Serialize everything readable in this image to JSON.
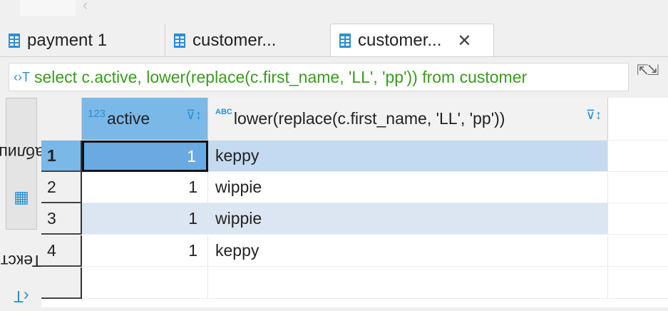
{
  "tabs": [
    {
      "label": "payment 1",
      "active": false
    },
    {
      "label": "customer...",
      "active": false
    },
    {
      "label": "customer...",
      "active": true
    }
  ],
  "query": "select c.active, lower(replace(c.first_name, 'LL', 'pp')) from customer",
  "side_tabs": {
    "table": "Таблица",
    "text": "Текст"
  },
  "grid": {
    "columns": [
      {
        "type_icon": "123",
        "label": "active"
      },
      {
        "type_icon": "ABC",
        "label": "lower(replace(c.first_name, 'LL', 'pp'))"
      }
    ],
    "rows": [
      {
        "num": "1",
        "active": "1",
        "lower": "keppy"
      },
      {
        "num": "2",
        "active": "1",
        "lower": "wippie"
      },
      {
        "num": "3",
        "active": "1",
        "lower": "wippie"
      },
      {
        "num": "4",
        "active": "1",
        "lower": "keppy"
      }
    ],
    "selected_row": 1
  },
  "colors": {
    "accent": "#2a8fd4",
    "header_selected": "#7ab8e8",
    "row_selected": "#c4daf0",
    "row_alt": "#dce6f2",
    "sql_green": "#3a9a1e"
  }
}
